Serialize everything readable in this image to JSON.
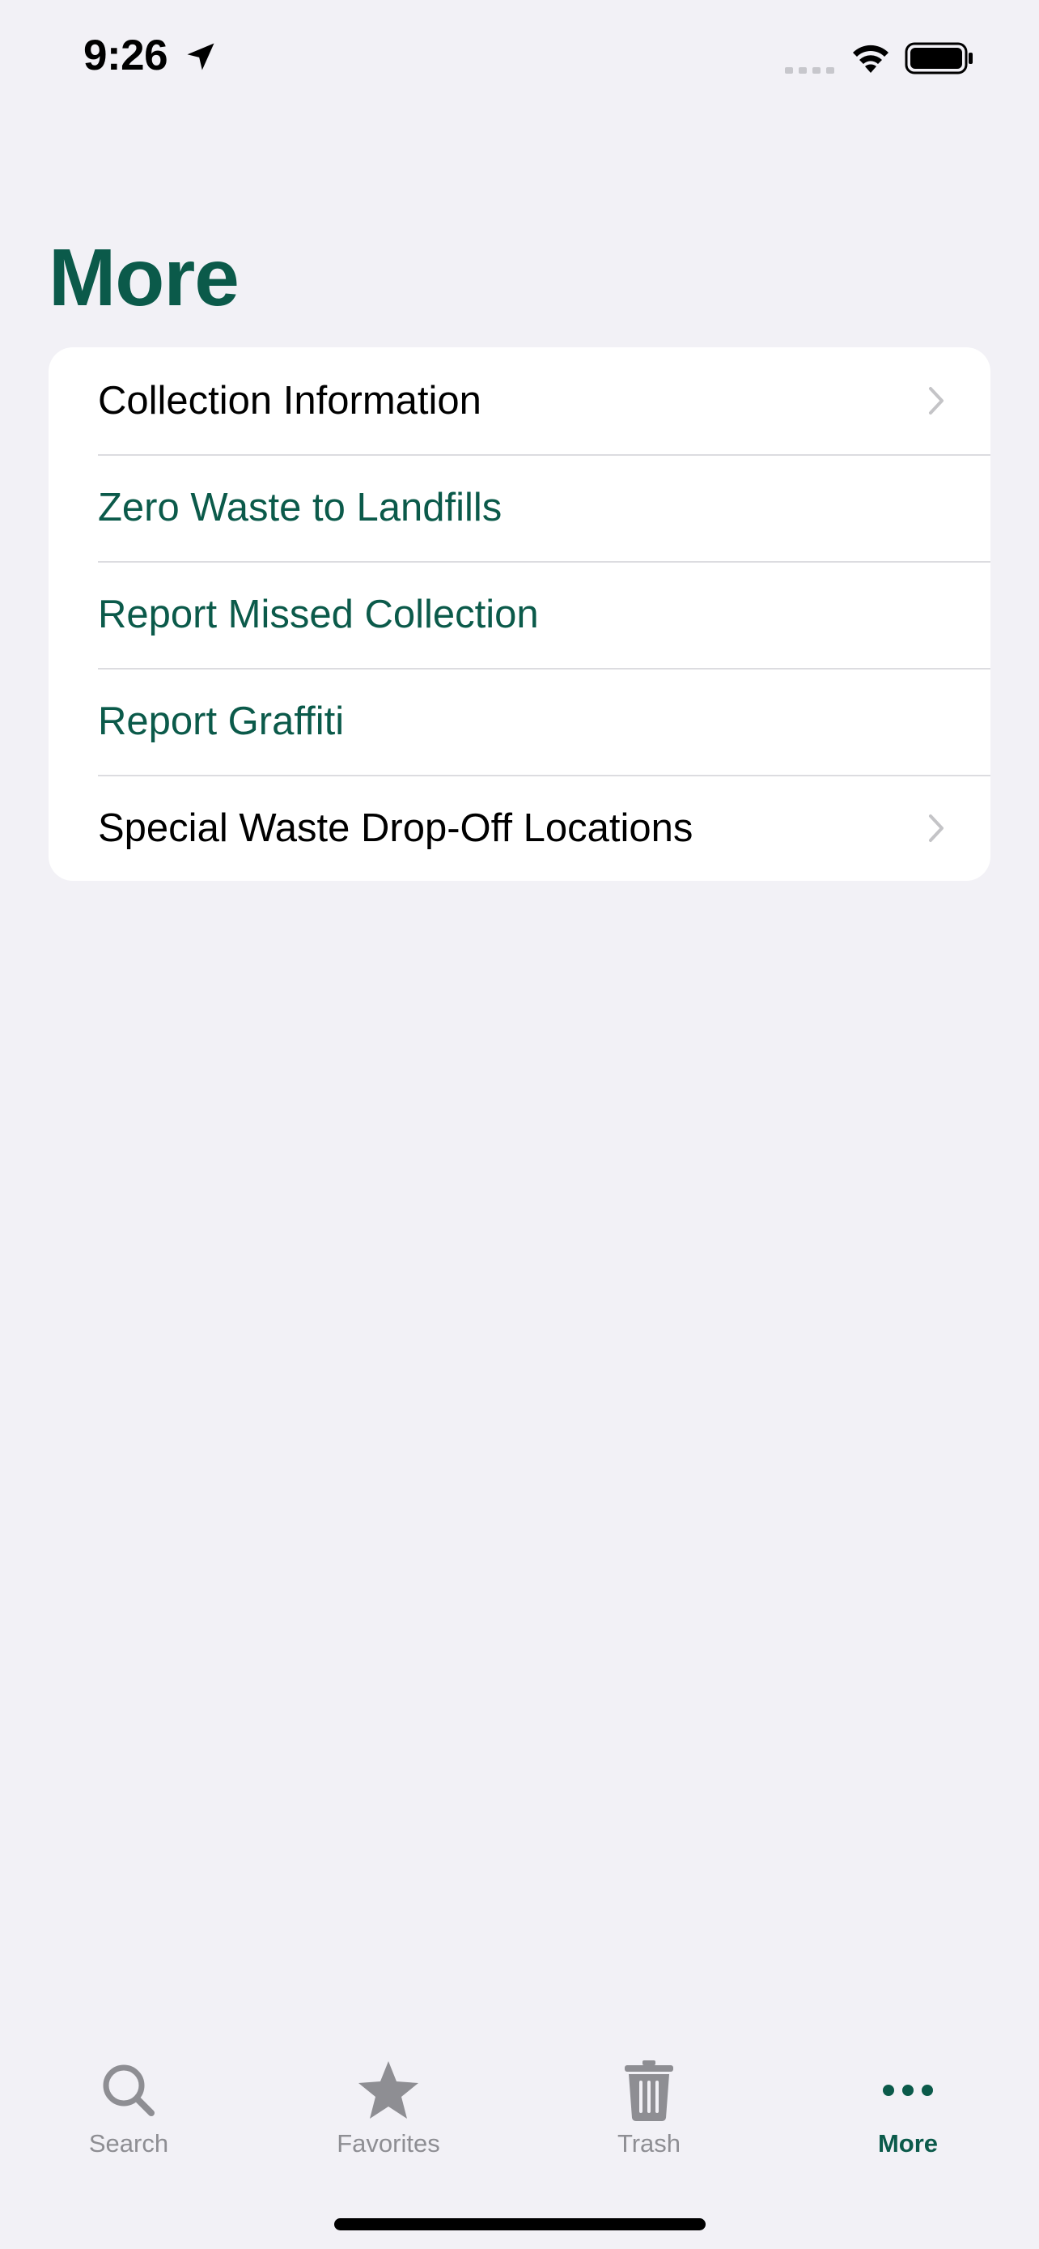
{
  "status_bar": {
    "time": "9:26",
    "icons": [
      "location-arrow-icon",
      "cellular-signal-icon",
      "wifi-icon",
      "battery-icon"
    ]
  },
  "header": {
    "title": "More"
  },
  "list": {
    "items": [
      {
        "label": "Collection Information",
        "style": "navigation",
        "chevron": true
      },
      {
        "label": "Zero Waste to Landfills",
        "style": "link",
        "chevron": false
      },
      {
        "label": "Report Missed Collection",
        "style": "link",
        "chevron": false
      },
      {
        "label": "Report Graffiti",
        "style": "link",
        "chevron": false
      },
      {
        "label": "Special Waste Drop-Off Locations",
        "style": "navigation",
        "chevron": true
      }
    ]
  },
  "tab_bar": {
    "tabs": [
      {
        "label": "Search",
        "icon": "magnifying-glass-icon",
        "selected": false
      },
      {
        "label": "Favorites",
        "icon": "star-icon",
        "selected": false
      },
      {
        "label": "Trash",
        "icon": "trash-can-icon",
        "selected": false
      },
      {
        "label": "More",
        "icon": "ellipsis-icon",
        "selected": true
      }
    ]
  },
  "colors": {
    "accent": "#0b5a4a",
    "background": "#f2f1f6",
    "card": "#ffffff",
    "inactive_tab": "#8e8e93",
    "chevron": "#c4c4c7",
    "separator": "#dcdce0"
  }
}
